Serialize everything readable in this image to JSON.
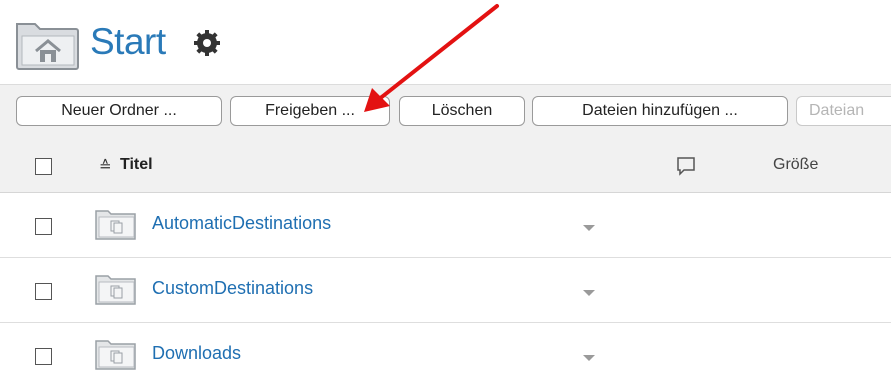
{
  "header": {
    "title": "Start",
    "home_icon": "home-folder-icon",
    "settings_icon": "gear-icon"
  },
  "toolbar": {
    "buttons": [
      {
        "label": "Neuer Ordner ..."
      },
      {
        "label": "Freigeben ..."
      },
      {
        "label": "Löschen"
      },
      {
        "label": "Dateien hinzufügen ..."
      },
      {
        "label": "Dateian",
        "disabled": true
      }
    ]
  },
  "table": {
    "columns": {
      "title": "Titel",
      "comments_icon": "comment-icon",
      "size": "Größe"
    },
    "rows": [
      {
        "name": "AutomaticDestinations"
      },
      {
        "name": "CustomDestinations"
      },
      {
        "name": "Downloads"
      }
    ]
  },
  "annotation": {
    "color": "#e31212",
    "target": "Freigeben ..."
  },
  "colors": {
    "link": "#1f6fb2",
    "title": "#2a7ab8",
    "toolbar_bg": "#f1f1f1"
  }
}
